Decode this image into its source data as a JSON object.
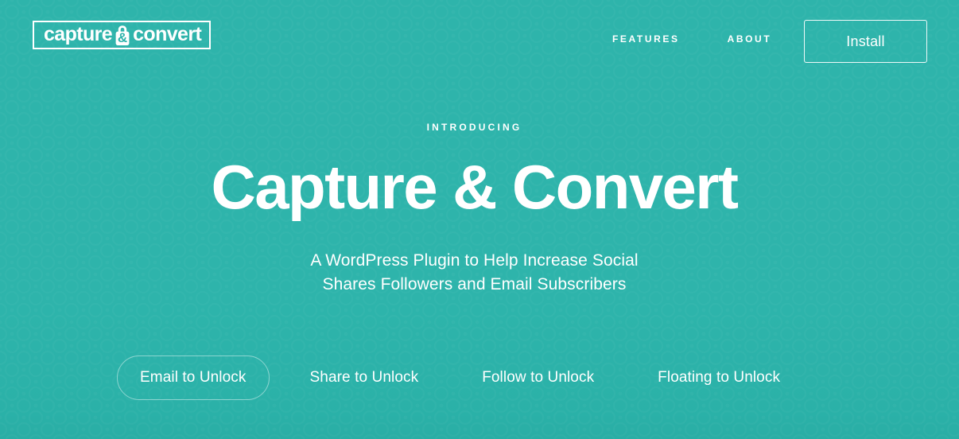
{
  "theme": {
    "background_color": "#2bb3aa",
    "text_color": "#ffffff",
    "border_color": "#ffffff"
  },
  "header": {
    "logo": {
      "word_one": "capture",
      "word_two": "convert",
      "icon": "padlock-ampersand-icon"
    },
    "nav": [
      {
        "label": "FEATURES"
      },
      {
        "label": "ABOUT"
      }
    ],
    "install_label": "Install"
  },
  "hero": {
    "eyebrow": "INTRODUCING",
    "headline": "Capture & Convert",
    "subheadline_line_1": "A WordPress Plugin to Help Increase Social",
    "subheadline_line_2": "Shares Followers and Email Subscribers"
  },
  "tabs": [
    {
      "label": "Email to Unlock",
      "active": true
    },
    {
      "label": "Share to Unlock",
      "active": false
    },
    {
      "label": "Follow to Unlock",
      "active": false
    },
    {
      "label": "Floating to Unlock",
      "active": false
    }
  ]
}
